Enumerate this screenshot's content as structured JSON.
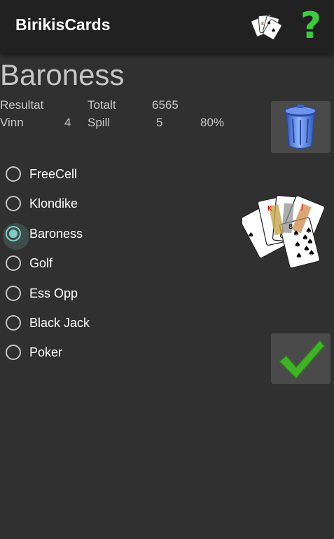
{
  "app": {
    "title": "BirikisCards"
  },
  "icons": {
    "cards": "playing-cards-icon",
    "help": "question-mark-icon",
    "help_glyph": "?",
    "trash": "trash-can-icon",
    "confirm": "checkmark-icon"
  },
  "game": {
    "name": "Baroness",
    "stats": {
      "result_label": "Resultat",
      "total_label": "Totalt",
      "total_value": "6565",
      "wins_label": "Vinn",
      "wins_value": "4",
      "games_label": "Spill",
      "games_value": "5",
      "win_percent": "80%"
    }
  },
  "games": [
    {
      "label": "FreeCell",
      "selected": false
    },
    {
      "label": "Klondike",
      "selected": false
    },
    {
      "label": "Baroness",
      "selected": true
    },
    {
      "label": "Golf",
      "selected": false
    },
    {
      "label": "Ess Opp",
      "selected": false
    },
    {
      "label": "Black Jack",
      "selected": false
    },
    {
      "label": "Poker",
      "selected": false
    }
  ],
  "colors": {
    "accent": "#80cbc4",
    "help": "#3ec93e",
    "check": "#43b02a",
    "trash": "#4f7fe0"
  }
}
